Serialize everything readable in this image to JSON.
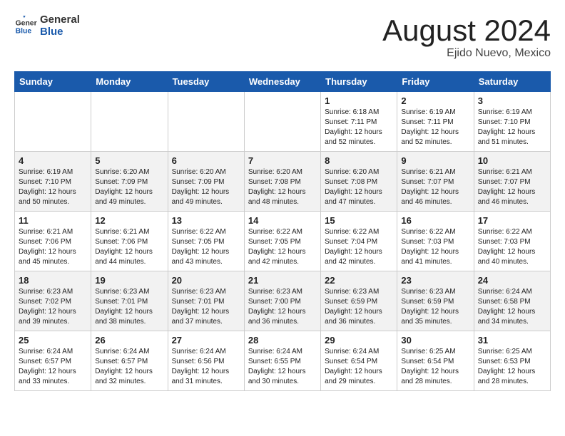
{
  "header": {
    "logo_general": "General",
    "logo_blue": "Blue",
    "month_year": "August 2024",
    "location": "Ejido Nuevo, Mexico"
  },
  "weekdays": [
    "Sunday",
    "Monday",
    "Tuesday",
    "Wednesday",
    "Thursday",
    "Friday",
    "Saturday"
  ],
  "weeks": [
    [
      {
        "day": "",
        "info": ""
      },
      {
        "day": "",
        "info": ""
      },
      {
        "day": "",
        "info": ""
      },
      {
        "day": "",
        "info": ""
      },
      {
        "day": "1",
        "info": "Sunrise: 6:18 AM\nSunset: 7:11 PM\nDaylight: 12 hours\nand 52 minutes."
      },
      {
        "day": "2",
        "info": "Sunrise: 6:19 AM\nSunset: 7:11 PM\nDaylight: 12 hours\nand 52 minutes."
      },
      {
        "day": "3",
        "info": "Sunrise: 6:19 AM\nSunset: 7:10 PM\nDaylight: 12 hours\nand 51 minutes."
      }
    ],
    [
      {
        "day": "4",
        "info": "Sunrise: 6:19 AM\nSunset: 7:10 PM\nDaylight: 12 hours\nand 50 minutes."
      },
      {
        "day": "5",
        "info": "Sunrise: 6:20 AM\nSunset: 7:09 PM\nDaylight: 12 hours\nand 49 minutes."
      },
      {
        "day": "6",
        "info": "Sunrise: 6:20 AM\nSunset: 7:09 PM\nDaylight: 12 hours\nand 49 minutes."
      },
      {
        "day": "7",
        "info": "Sunrise: 6:20 AM\nSunset: 7:08 PM\nDaylight: 12 hours\nand 48 minutes."
      },
      {
        "day": "8",
        "info": "Sunrise: 6:20 AM\nSunset: 7:08 PM\nDaylight: 12 hours\nand 47 minutes."
      },
      {
        "day": "9",
        "info": "Sunrise: 6:21 AM\nSunset: 7:07 PM\nDaylight: 12 hours\nand 46 minutes."
      },
      {
        "day": "10",
        "info": "Sunrise: 6:21 AM\nSunset: 7:07 PM\nDaylight: 12 hours\nand 46 minutes."
      }
    ],
    [
      {
        "day": "11",
        "info": "Sunrise: 6:21 AM\nSunset: 7:06 PM\nDaylight: 12 hours\nand 45 minutes."
      },
      {
        "day": "12",
        "info": "Sunrise: 6:21 AM\nSunset: 7:06 PM\nDaylight: 12 hours\nand 44 minutes."
      },
      {
        "day": "13",
        "info": "Sunrise: 6:22 AM\nSunset: 7:05 PM\nDaylight: 12 hours\nand 43 minutes."
      },
      {
        "day": "14",
        "info": "Sunrise: 6:22 AM\nSunset: 7:05 PM\nDaylight: 12 hours\nand 42 minutes."
      },
      {
        "day": "15",
        "info": "Sunrise: 6:22 AM\nSunset: 7:04 PM\nDaylight: 12 hours\nand 42 minutes."
      },
      {
        "day": "16",
        "info": "Sunrise: 6:22 AM\nSunset: 7:03 PM\nDaylight: 12 hours\nand 41 minutes."
      },
      {
        "day": "17",
        "info": "Sunrise: 6:22 AM\nSunset: 7:03 PM\nDaylight: 12 hours\nand 40 minutes."
      }
    ],
    [
      {
        "day": "18",
        "info": "Sunrise: 6:23 AM\nSunset: 7:02 PM\nDaylight: 12 hours\nand 39 minutes."
      },
      {
        "day": "19",
        "info": "Sunrise: 6:23 AM\nSunset: 7:01 PM\nDaylight: 12 hours\nand 38 minutes."
      },
      {
        "day": "20",
        "info": "Sunrise: 6:23 AM\nSunset: 7:01 PM\nDaylight: 12 hours\nand 37 minutes."
      },
      {
        "day": "21",
        "info": "Sunrise: 6:23 AM\nSunset: 7:00 PM\nDaylight: 12 hours\nand 36 minutes."
      },
      {
        "day": "22",
        "info": "Sunrise: 6:23 AM\nSunset: 6:59 PM\nDaylight: 12 hours\nand 36 minutes."
      },
      {
        "day": "23",
        "info": "Sunrise: 6:23 AM\nSunset: 6:59 PM\nDaylight: 12 hours\nand 35 minutes."
      },
      {
        "day": "24",
        "info": "Sunrise: 6:24 AM\nSunset: 6:58 PM\nDaylight: 12 hours\nand 34 minutes."
      }
    ],
    [
      {
        "day": "25",
        "info": "Sunrise: 6:24 AM\nSunset: 6:57 PM\nDaylight: 12 hours\nand 33 minutes."
      },
      {
        "day": "26",
        "info": "Sunrise: 6:24 AM\nSunset: 6:57 PM\nDaylight: 12 hours\nand 32 minutes."
      },
      {
        "day": "27",
        "info": "Sunrise: 6:24 AM\nSunset: 6:56 PM\nDaylight: 12 hours\nand 31 minutes."
      },
      {
        "day": "28",
        "info": "Sunrise: 6:24 AM\nSunset: 6:55 PM\nDaylight: 12 hours\nand 30 minutes."
      },
      {
        "day": "29",
        "info": "Sunrise: 6:24 AM\nSunset: 6:54 PM\nDaylight: 12 hours\nand 29 minutes."
      },
      {
        "day": "30",
        "info": "Sunrise: 6:25 AM\nSunset: 6:54 PM\nDaylight: 12 hours\nand 28 minutes."
      },
      {
        "day": "31",
        "info": "Sunrise: 6:25 AM\nSunset: 6:53 PM\nDaylight: 12 hours\nand 28 minutes."
      }
    ]
  ]
}
